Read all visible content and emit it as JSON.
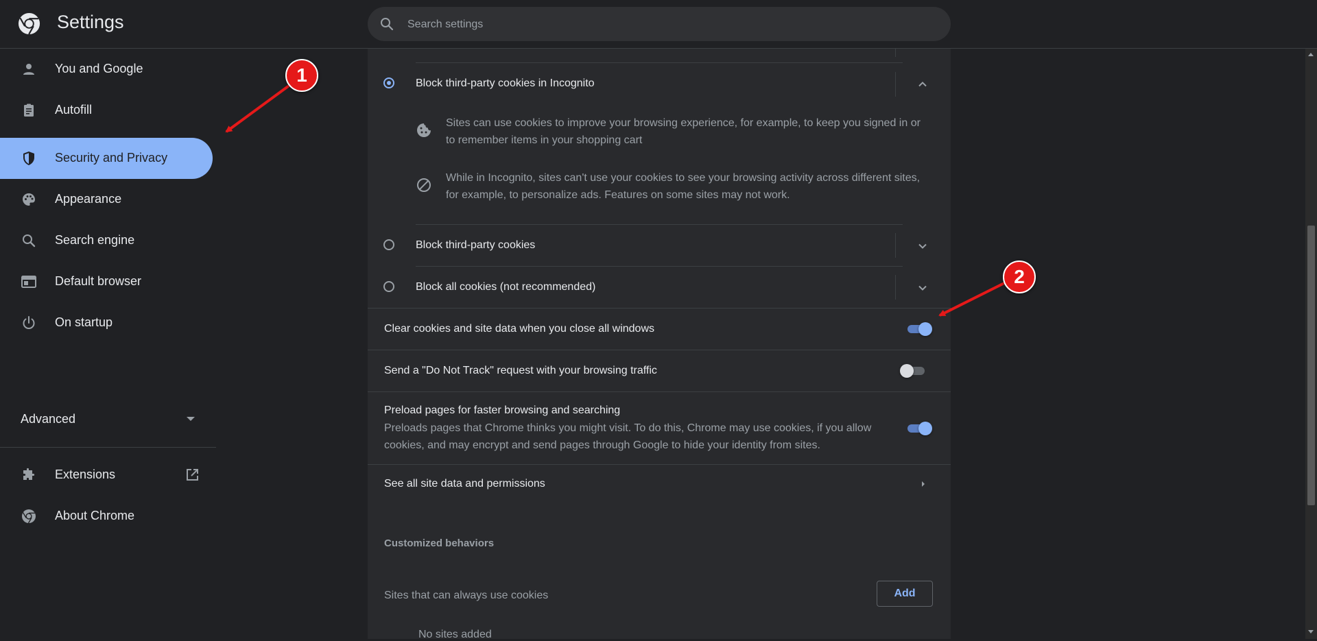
{
  "app": {
    "title": "Settings",
    "logo_icon": "chrome-logo-icon"
  },
  "search": {
    "placeholder": "Search settings"
  },
  "sidebar": {
    "items": [
      {
        "label": "You and Google",
        "icon": "person-icon"
      },
      {
        "label": "Autofill",
        "icon": "clipboard-icon"
      },
      {
        "label": "Security and Privacy",
        "icon": "shield-icon",
        "active": true
      },
      {
        "label": "Appearance",
        "icon": "palette-icon"
      },
      {
        "label": "Search engine",
        "icon": "search-icon"
      },
      {
        "label": "Default browser",
        "icon": "browser-window-icon"
      },
      {
        "label": "On startup",
        "icon": "power-icon"
      }
    ],
    "advanced_label": "Advanced",
    "footer_items": [
      {
        "label": "Extensions",
        "icon": "puzzle-icon",
        "trailing_icon": "open-in-new-icon"
      },
      {
        "label": "About Chrome",
        "icon": "chrome-icon"
      }
    ]
  },
  "cookies": {
    "options": [
      {
        "label": "Block third-party cookies in Incognito",
        "selected": true,
        "expanded": true
      },
      {
        "label": "Block third-party cookies",
        "selected": false,
        "expanded": false
      },
      {
        "label": "Block all cookies (not recommended)",
        "selected": false,
        "expanded": false
      }
    ],
    "details": [
      {
        "icon": "cookie-icon",
        "text": "Sites can use cookies to improve your browsing experience, for example, to keep you signed in or to remember items in your shopping cart"
      },
      {
        "icon": "block-icon",
        "text": "While in Incognito, sites can't use your cookies to see your browsing activity across different sites, for example, to personalize ads. Features on some sites may not work."
      }
    ]
  },
  "toggles": [
    {
      "label": "Clear cookies and site data when you close all windows",
      "on": true
    },
    {
      "label": "Send a \"Do Not Track\" request with your browsing traffic",
      "on": false
    },
    {
      "label": "Preload pages for faster browsing and searching",
      "description": "Preloads pages that Chrome thinks you might visit. To do this, Chrome may use cookies, if you allow cookies, and may encrypt and send pages through Google to hide your identity from sites.",
      "on": true
    }
  ],
  "site_data_link": "See all site data and permissions",
  "customized": {
    "heading": "Customized behaviors",
    "allow_label": "Sites that can always use cookies",
    "add_label": "Add",
    "empty_text": "No sites added"
  },
  "annotations": {
    "marker1": "1",
    "marker2": "2"
  },
  "colors": {
    "accent": "#8ab4f8",
    "background": "#202124",
    "card": "#292a2d",
    "marker": "#e51919"
  }
}
